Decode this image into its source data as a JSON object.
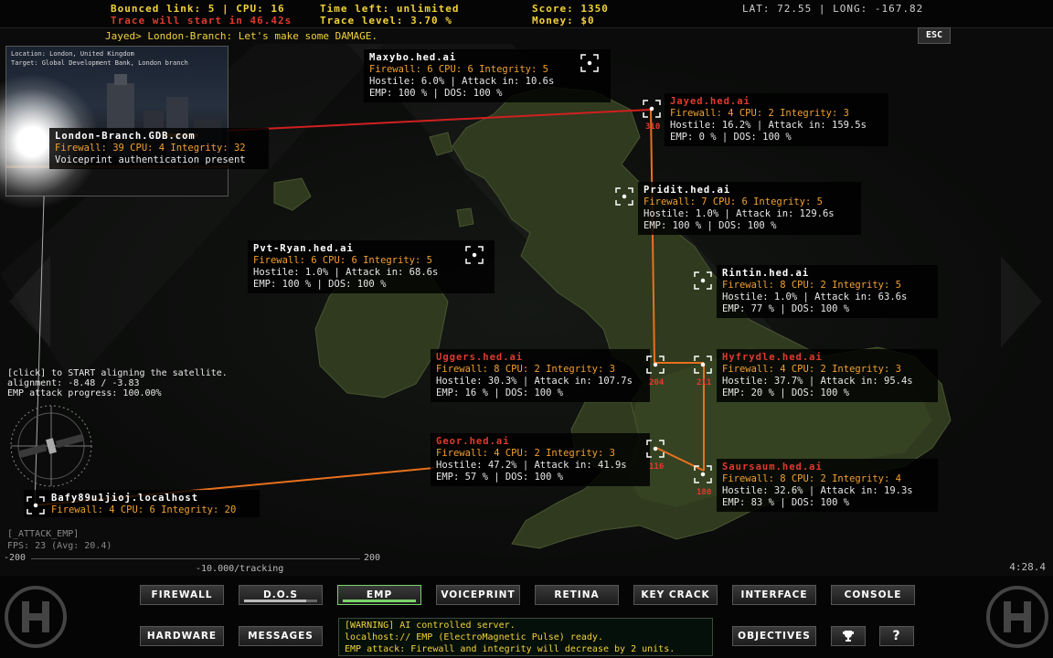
{
  "topbar": {
    "bounced_link": "Bounced link: 5 | CPU: 16",
    "trace_start": "Trace will start in 46.42s",
    "time_left": "Time left: unlimited",
    "trace_level": "Trace level: 3.70 %",
    "score": "Score: 1350",
    "money": "Money: $0",
    "coords": "LAT: 72.55 | LONG: -167.82",
    "esc": "ESC"
  },
  "chat": "Jayed> London-Branch: Let's make some DAMAGE.",
  "photo": {
    "location": "Location: London, United Kingdom",
    "target": "Target: Global Development Bank, London branch"
  },
  "nodes": [
    {
      "id": "london",
      "name": "London-Branch.GDB.com",
      "fw": "Firewall: 39 CPU: 4 Integrity: 32",
      "line2": "Voiceprint authentication present",
      "line3": "",
      "hostile": false
    },
    {
      "id": "maxybo",
      "name": "Maxybo.hed.ai",
      "fw": "Firewall: 6 CPU: 6 Integrity: 5",
      "line2": "Hostile: 6.0% | Attack in: 10.6s",
      "line3": "EMP: 100 % | DOS: 100 %",
      "hostile": false
    },
    {
      "id": "jayed",
      "name": "Jayed.hed.ai",
      "fw": "Firewall: 4 CPU: 2 Integrity: 3",
      "line2": "Hostile: 16.2% | Attack in: 159.5s",
      "line3": "EMP:   0 % | DOS: 100 %",
      "hostile": true,
      "num": "310"
    },
    {
      "id": "pridit",
      "name": "Pridit.hed.ai",
      "fw": "Firewall: 7 CPU: 6 Integrity: 5",
      "line2": "Hostile: 1.0% | Attack in: 129.6s",
      "line3": "EMP: 100 % | DOS: 100 %",
      "hostile": false
    },
    {
      "id": "pvtryan",
      "name": "Pvt-Ryan.hed.ai",
      "fw": "Firewall: 6 CPU: 6 Integrity: 5",
      "line2": "Hostile: 1.0% | Attack in: 68.6s",
      "line3": "EMP: 100 % | DOS: 100 %",
      "hostile": false
    },
    {
      "id": "rintin",
      "name": "Rintin.hed.ai",
      "fw": "Firewall: 8 CPU: 2 Integrity: 5",
      "line2": "Hostile: 1.0% | Attack in: 63.6s",
      "line3": "EMP:  77 % | DOS: 100 %",
      "hostile": false
    },
    {
      "id": "uggers",
      "name": "Uggers.hed.ai",
      "fw": "Firewall: 8 CPU: 2 Integrity: 3",
      "line2": "Hostile: 30.3% | Attack in: 107.7s",
      "line3": "EMP:  16 % | DOS: 100 %",
      "hostile": true,
      "num": "204"
    },
    {
      "id": "hyfrydle",
      "name": "Hyfrydle.hed.ai",
      "fw": "Firewall: 4 CPU: 2 Integrity: 3",
      "line2": "Hostile: 37.7% | Attack in: 95.4s",
      "line3": "EMP:  20 % | DOS: 100 %",
      "hostile": true,
      "num": "211"
    },
    {
      "id": "geor",
      "name": "Geor.hed.ai",
      "fw": "Firewall: 4 CPU: 2 Integrity: 3",
      "line2": "Hostile: 47.2% | Attack in: 41.9s",
      "line3": "EMP:  57 % | DOS: 100 %",
      "hostile": true,
      "num": "116"
    },
    {
      "id": "saursaum",
      "name": "Saursaum.hed.ai",
      "fw": "Firewall: 8 CPU: 2 Integrity: 4",
      "line2": "Hostile: 32.6% | Attack in: 19.3s",
      "line3": "EMP:  83 % | DOS: 100 %",
      "hostile": true,
      "num": "180"
    },
    {
      "id": "local",
      "name": "Bafy89u1jioj.localhost",
      "fw": "Firewall: 4 CPU: 6 Integrity: 20",
      "line2": "",
      "line3": "",
      "hostile": false
    }
  ],
  "satellite": {
    "instruction": "[click] to START aligning the satellite.",
    "alignment": "alignment: -8.48 / -3.83",
    "progress": "EMP attack progress: 100.00%"
  },
  "fps": {
    "attack": "[_ATTACK_EMP]",
    "fps": "FPS: 23 (Avg: 20.4)"
  },
  "gauge": {
    "min": "-200",
    "max": "200",
    "tracking": "-10.000/tracking"
  },
  "clock": "4:28.4",
  "buttons_row1": [
    {
      "label": "FIREWALL",
      "progress": 0
    },
    {
      "label": "D.O.S",
      "progress": 0.85
    },
    {
      "label": "EMP",
      "progress": 1.0,
      "active": true
    },
    {
      "label": "VOICEPRINT",
      "progress": 0
    },
    {
      "label": "RETINA",
      "progress": 0
    },
    {
      "label": "KEY CRACK",
      "progress": 0
    },
    {
      "label": "INTERFACE",
      "progress": 0
    },
    {
      "label": "CONSOLE",
      "progress": 0
    }
  ],
  "buttons_row2": {
    "hardware": "HARDWARE",
    "messages": "MESSAGES",
    "objectives": "OBJECTIVES",
    "trophy_icon": "trophy-icon",
    "help": "?"
  },
  "log": [
    "[WARNING] AI controlled server.",
    "localhost:// EMP (ElectroMagnetic Pulse) ready.",
    "EMP attack: Firewall and integrity will decrease by 2 units."
  ],
  "colors": {
    "accent": "#f2d23a",
    "hostile": "#e03a2e",
    "firewall": "#f2a030",
    "link": "#e8701e",
    "active": "#7ad26a"
  }
}
